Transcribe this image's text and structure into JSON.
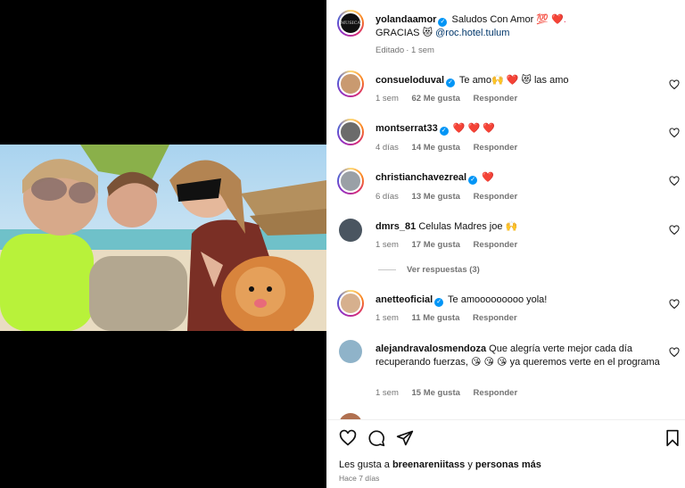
{
  "post": {
    "author": "yolandaamor",
    "caption_text": "Saludos Con Amor",
    "caption_emoji": "💯 ❤️.",
    "caption_line2": "GRACIAS",
    "caption_emoji2": "😻",
    "mention": "@roc.hotel.tulum",
    "edited_label": "Editado",
    "edited_time": "1 sem",
    "avatar_text": "MUSICA"
  },
  "comments": [
    {
      "user": "consueloduval",
      "verified": true,
      "text": "Te amo🙌 ❤️  😻 las amo",
      "time": "1 sem",
      "likes": "62 Me gusta",
      "reply": "Responder"
    },
    {
      "user": "montserrat33",
      "verified": true,
      "text": "❤️ ❤️ ❤️",
      "time": "4 días",
      "likes": "14 Me gusta",
      "reply": "Responder"
    },
    {
      "user": "christianchavezreal",
      "verified": true,
      "text": "❤️",
      "time": "6 días",
      "likes": "13 Me gusta",
      "reply": "Responder"
    },
    {
      "user": "dmrs_81",
      "verified": false,
      "text": "Celulas Madres joe 🙌",
      "time": "1 sem",
      "likes": "17 Me gusta",
      "reply": "Responder"
    },
    {
      "user": "anetteoficial",
      "verified": true,
      "text": "Te amooooooooo yola!",
      "time": "1 sem",
      "likes": "11 Me gusta",
      "reply": "Responder"
    },
    {
      "user": "alejandravalosmendoza",
      "verified": false,
      "text": "Que alegría verte mejor cada día recuperando fuerzas, 😘 😘 😘 ya queremos verte en el programa",
      "time": "1 sem",
      "likes": "15 Me gusta",
      "reply": "Responder"
    }
  ],
  "view_replies": "Ver respuestas (3)",
  "footer": {
    "likes_prefix": "Les gusta a",
    "likes_user": "breenareniitass",
    "likes_mid": "y",
    "likes_others": "personas más",
    "time": "Hace 7 días"
  },
  "colors": {
    "verified": "#0095f6",
    "heart": "#e8355c",
    "mention": "#00376b",
    "muted": "#737373"
  }
}
